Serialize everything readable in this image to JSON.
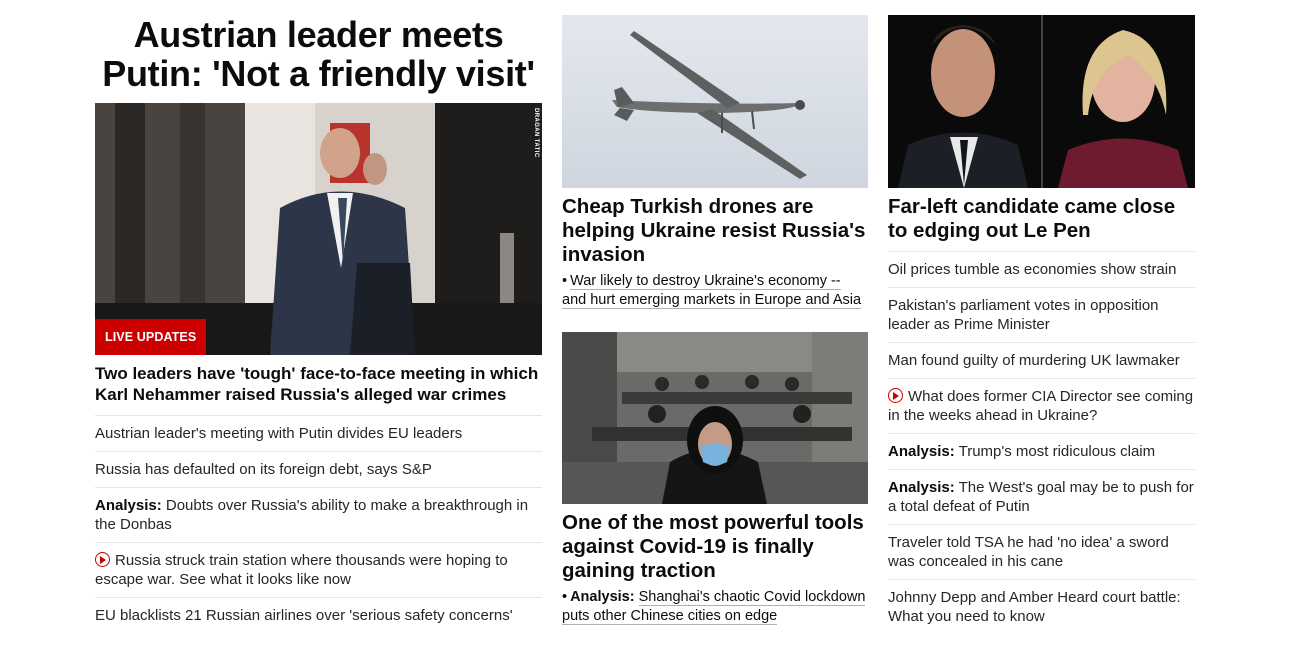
{
  "lead": {
    "headline": "Austrian leader meets Putin: 'Not a friendly visit'",
    "image_credit": "DRAGAN TATIC",
    "badge": "LIVE UPDATES",
    "subhead": "Two leaders have 'tough' face-to-face meeting in which Karl Nehammer raised Russia's alleged war crimes",
    "items": [
      {
        "label": "",
        "text": "Austrian leader's meeting with Putin divides EU leaders",
        "video": false
      },
      {
        "label": "",
        "text": "Russia has defaulted on its foreign debt, says S&P",
        "video": false
      },
      {
        "label": "Analysis:",
        "text": " Doubts over Russia's ability to make a breakthrough in the Donbas",
        "video": false
      },
      {
        "label": "",
        "text": "Russia struck train station where thousands were hoping to escape war. See what it looks like now",
        "video": true
      },
      {
        "label": "",
        "text": "EU blacklists 21 Russian airlines over 'serious safety concerns'",
        "video": false
      }
    ]
  },
  "middle": {
    "card1": {
      "headline": "Cheap Turkish drones are helping Ukraine resist Russia's invasion",
      "bullet": "•",
      "link": "War likely to destroy Ukraine's economy -- and hurt emerging markets in Europe and Asia"
    },
    "card2": {
      "headline": "One of the most powerful tools against Covid-19 is finally gaining traction",
      "bullet": "•",
      "label": "Analysis:",
      "link": "Shanghai's chaotic Covid lockdown puts other Chinese cities on edge"
    }
  },
  "right": {
    "headline": "Far-left candidate came close to edging out Le Pen",
    "items": [
      {
        "label": "",
        "text": "Oil prices tumble as economies show strain",
        "video": false
      },
      {
        "label": "",
        "text": "Pakistan's parliament votes in opposition leader as Prime Minister",
        "video": false
      },
      {
        "label": "",
        "text": "Man found guilty of murdering UK lawmaker",
        "video": false
      },
      {
        "label": "",
        "text": "What does former CIA Director see coming in the weeks ahead in Ukraine?",
        "video": true
      },
      {
        "label": "Analysis:",
        "text": " Trump's most ridiculous claim",
        "video": false
      },
      {
        "label": "Analysis:",
        "text": " The West's goal may be to push for a total defeat of Putin",
        "video": false
      },
      {
        "label": "",
        "text": "Traveler told TSA he had 'no idea' a sword was concealed in his cane",
        "video": false
      },
      {
        "label": "",
        "text": "Johnny Depp and Amber Heard court battle: What you need to know",
        "video": false
      }
    ]
  },
  "colors": {
    "accent": "#cc0000",
    "divider": "#e6e6e6"
  }
}
